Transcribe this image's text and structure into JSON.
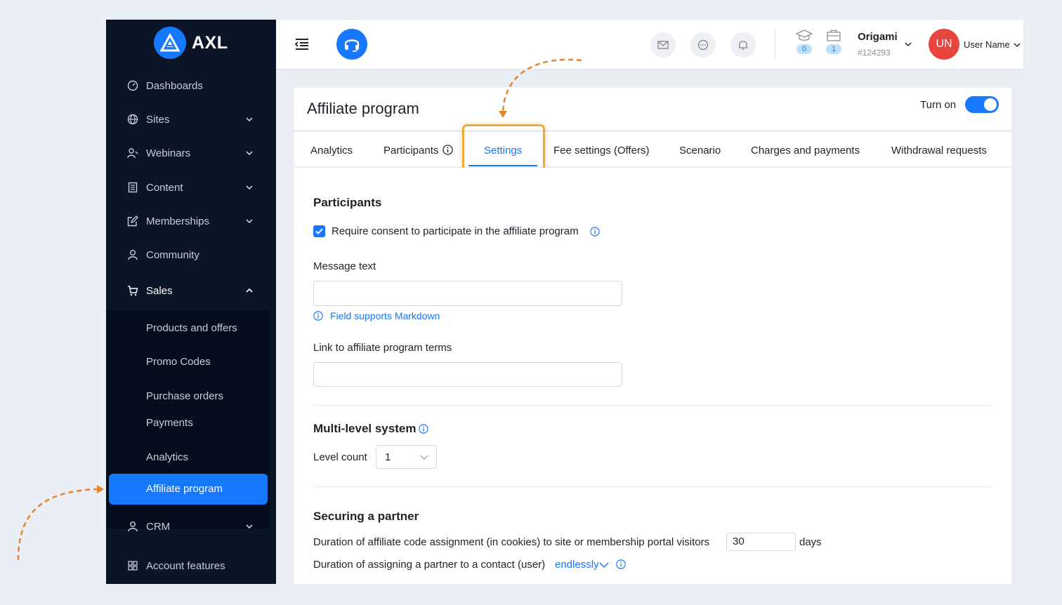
{
  "brand": {
    "logo_text": "AXL"
  },
  "sidebar": {
    "items": [
      {
        "label": "Dashboards"
      },
      {
        "label": "Sites"
      },
      {
        "label": "Webinars"
      },
      {
        "label": "Content"
      },
      {
        "label": "Memberships"
      },
      {
        "label": "Community"
      },
      {
        "label": "Sales"
      },
      {
        "label": "CRM"
      },
      {
        "label": "Account features"
      }
    ],
    "sales_submenu": [
      {
        "label": "Products and offers"
      },
      {
        "label": "Promo Codes"
      },
      {
        "label": "Purchase orders"
      },
      {
        "label": "Payments"
      },
      {
        "label": "Analytics"
      },
      {
        "label": "Affiliate program"
      }
    ]
  },
  "header": {
    "courses_count": "0",
    "inbox_count": "1",
    "org_name": "Origami",
    "org_id": "#124293",
    "avatar_initials": "UN",
    "user_name": "User Name"
  },
  "page": {
    "title": "Affiliate program",
    "toggle_label": "Turn on",
    "toggle_on": true,
    "tabs": [
      {
        "label": "Analytics"
      },
      {
        "label": "Participants"
      },
      {
        "label": "Settings"
      },
      {
        "label": "Fee settings (Offers)"
      },
      {
        "label": "Scenario"
      },
      {
        "label": "Charges and payments"
      },
      {
        "label": "Withdrawal requests"
      }
    ],
    "active_tab": "Settings"
  },
  "participants": {
    "title": "Participants",
    "consent_label": "Require consent to participate in the affiliate program",
    "consent_checked": true,
    "message_label": "Message text",
    "message_value": "",
    "markdown_hint": "Field supports Markdown",
    "terms_label": "Link to affiliate program terms",
    "terms_value": ""
  },
  "multilevel": {
    "title": "Multi-level system",
    "level_label": "Level count",
    "level_value": "1"
  },
  "securing": {
    "title": "Securing a partner",
    "cookie_label": "Duration of affiliate code assignment (in cookies) to site or membership portal visitors",
    "cookie_value": "30",
    "cookie_unit": "days",
    "contact_label": "Duration of assigning a partner to a contact (user)",
    "contact_value": "endlessly"
  },
  "colors": {
    "accent": "#1677ff",
    "sidebar_bg": "#0a1628",
    "highlight": "#f0a93a",
    "avatar": "#e8453c"
  }
}
